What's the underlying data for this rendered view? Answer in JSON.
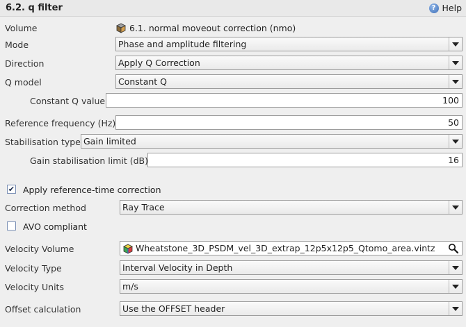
{
  "header": {
    "title": "6.2. q filter",
    "help_label": "Help"
  },
  "volume": {
    "label": "Volume",
    "value": "6.1. normal moveout correction (nmo)"
  },
  "mode": {
    "label": "Mode",
    "value": "Phase and amplitude filtering"
  },
  "direction": {
    "label": "Direction",
    "value": "Apply Q Correction"
  },
  "q_model": {
    "label": "Q model",
    "value": "Constant Q"
  },
  "constant_q": {
    "label": "Constant Q value",
    "value": "100"
  },
  "ref_freq": {
    "label": "Reference frequency (Hz)",
    "value": "50"
  },
  "stabilisation": {
    "label": "Stabilisation type",
    "value": "Gain limited"
  },
  "gain_limit": {
    "label": "Gain stabilisation limit (dB)",
    "value": "16"
  },
  "ref_time": {
    "label": "Apply reference-time correction",
    "checked": true
  },
  "correction_method": {
    "label": "Correction method",
    "value": "Ray Trace"
  },
  "avo": {
    "label": "AVO compliant",
    "checked": false
  },
  "velocity_volume": {
    "label": "Velocity Volume",
    "value": "Wheatstone_3D_PSDM_vel_3D_extrap_12p5x12p5_Qtomo_area.vintz"
  },
  "velocity_type": {
    "label": "Velocity Type",
    "value": "Interval Velocity in Depth"
  },
  "velocity_units": {
    "label": "Velocity Units",
    "value": "m/s"
  },
  "offset_calc": {
    "label": "Offset calculation",
    "value": "Use the OFFSET header"
  }
}
